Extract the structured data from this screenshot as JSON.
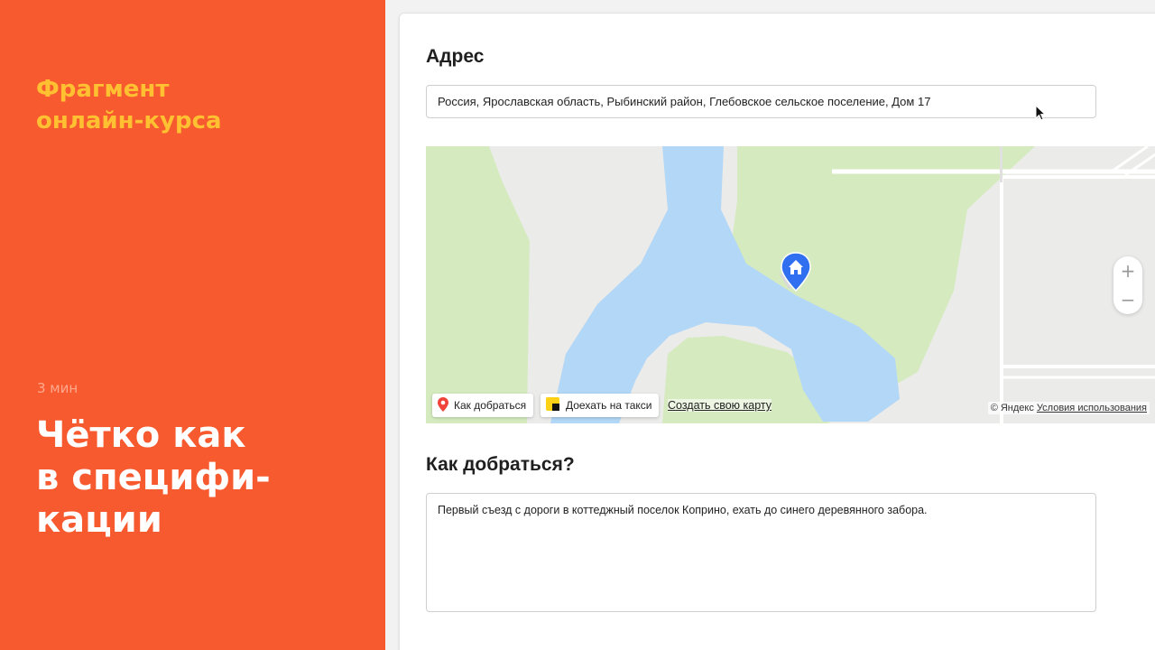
{
  "promo": {
    "fragment_line1": "Фрагмент",
    "fragment_line2": "онлайн-курса",
    "duration": "3 мин",
    "title_line1": "Чётко как",
    "title_line2": "в специфи-",
    "title_line3": "кации"
  },
  "form": {
    "address_heading": "Адрес",
    "address_value": "Россия, Ярославская область, Рыбинский район, Глебовское сельское поселение, Дом 17",
    "map": {
      "route_button": "Как добраться",
      "taxi_button": "Доехать на такси",
      "create_map_link": "Создать свою карту",
      "copyright": "© Яндекс",
      "terms_link": "Условия использования",
      "zoom_in": "+",
      "zoom_out": "−"
    },
    "howto_heading": "Как добраться?",
    "howto_value": "Первый съезд с дороги в коттеджный поселок Коприно, ехать до синего деревянного забора."
  },
  "colors": {
    "promo_bg": "#f75a2e",
    "promo_accent": "#ffc132",
    "map_water": "#b3d7f6",
    "map_green": "#d5ebbf",
    "pin_blue": "#2f6ff0"
  },
  "icons": [
    "map-pin-icon",
    "taxi-icon",
    "home-pin-icon",
    "mouse-cursor-icon"
  ]
}
